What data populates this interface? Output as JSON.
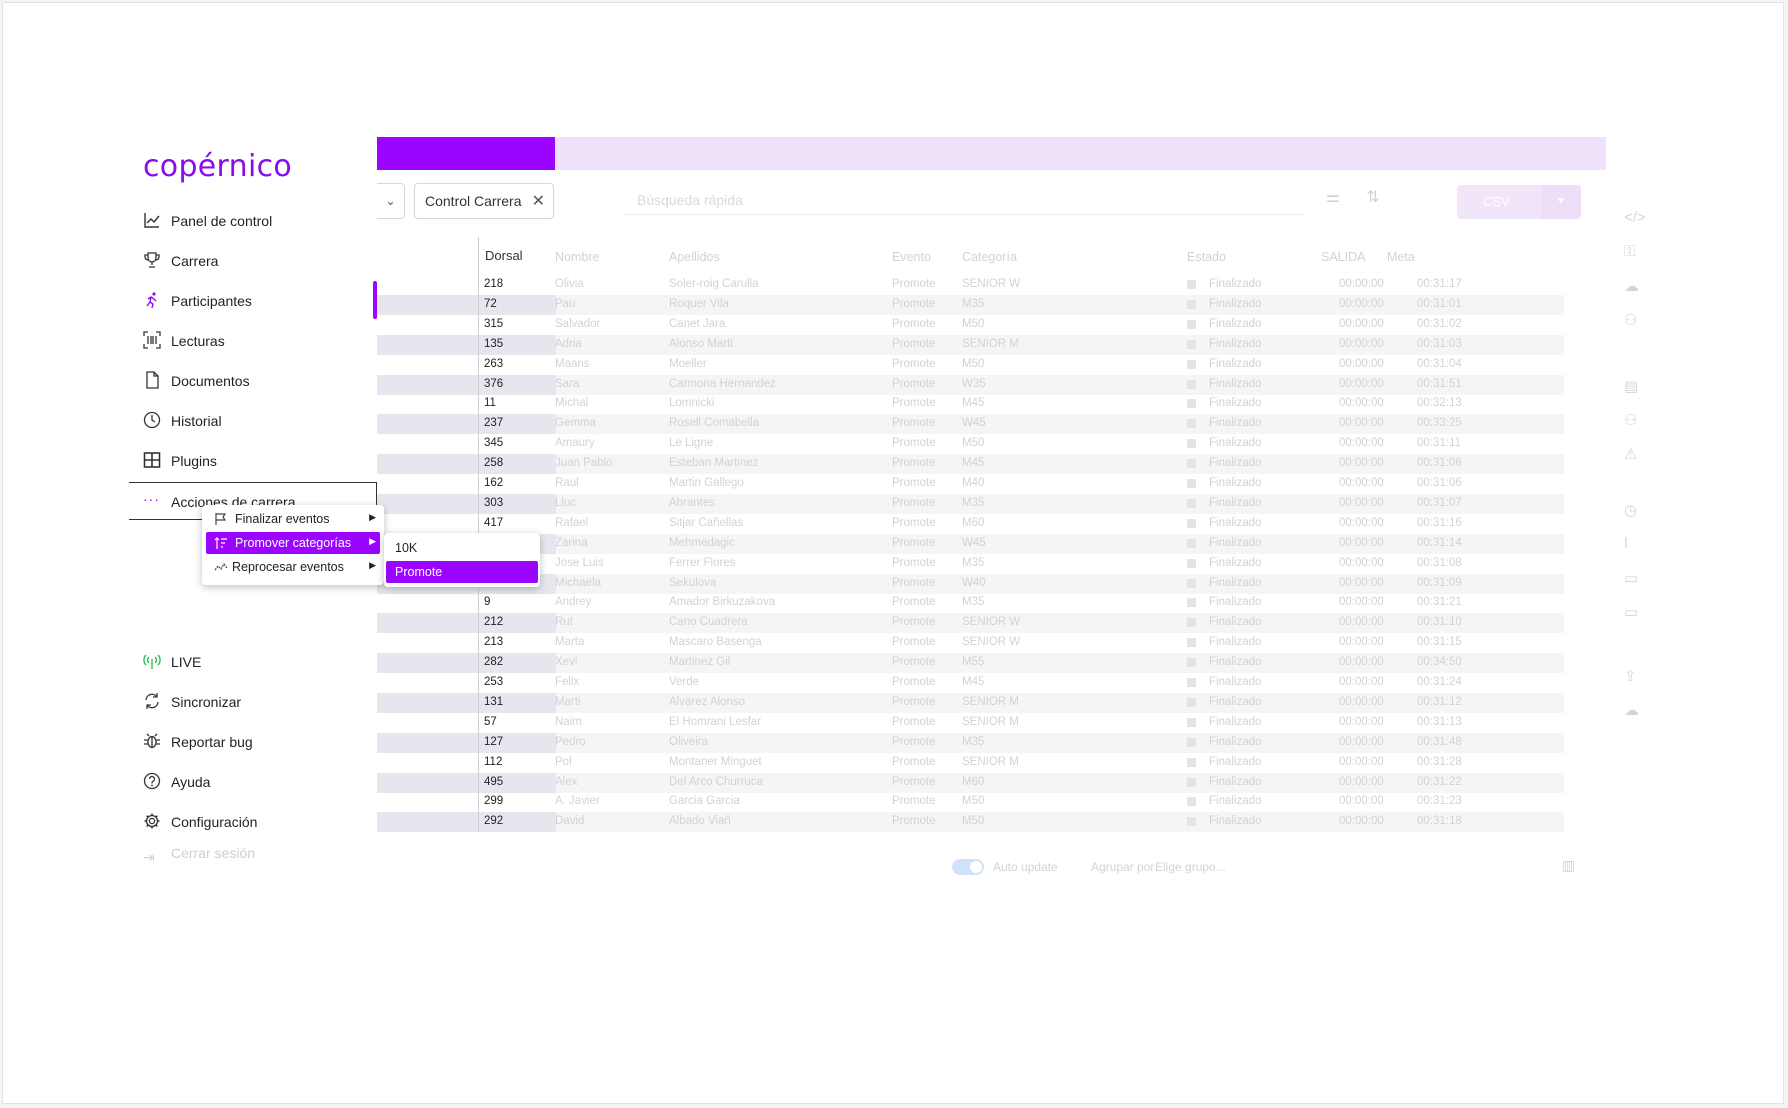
{
  "brand": {
    "logo_text": "copérnico",
    "accent": "#9b05ff"
  },
  "toolbar": {
    "filter_chip": "Control Carrera",
    "search_placeholder": "Búsqueda rápida",
    "csv_label": "CSV"
  },
  "sidebar": {
    "items": [
      {
        "label": "Panel de control",
        "icon": "chart-line-icon"
      },
      {
        "label": "Carrera",
        "icon": "trophy-icon"
      },
      {
        "label": "Participantes",
        "icon": "runner-icon"
      },
      {
        "label": "Lecturas",
        "icon": "barcode-icon"
      },
      {
        "label": "Documentos",
        "icon": "document-icon"
      },
      {
        "label": "Historial",
        "icon": "clock-icon"
      },
      {
        "label": "Plugins",
        "icon": "grid-icon"
      },
      {
        "label": "Acciones de carrera",
        "icon": "dots-icon"
      }
    ],
    "bottom_items": [
      {
        "label": "LIVE",
        "icon": "antenna-icon"
      },
      {
        "label": "Sincronizar",
        "icon": "sync-icon"
      },
      {
        "label": "Reportar bug",
        "icon": "bug-icon"
      },
      {
        "label": "Ayuda",
        "icon": "help-icon"
      },
      {
        "label": "Configuración",
        "icon": "gear-icon"
      }
    ],
    "logout": {
      "label": "Cerrar sesión"
    }
  },
  "context_menu": {
    "items": [
      {
        "label": "Finalizar eventos",
        "icon": "flag-icon"
      },
      {
        "label": "Promover categorías",
        "icon": "sort-up-icon"
      },
      {
        "label": "Reprocesar eventos",
        "icon": "reprocess-icon"
      }
    ],
    "submenu": [
      {
        "label": "10K"
      },
      {
        "label": "Promote"
      }
    ]
  },
  "table": {
    "headers": [
      "Dorsal",
      "Nombre",
      "Apellidos",
      "Evento",
      "Categoría",
      "Estado",
      "SALIDA",
      "Meta"
    ],
    "rows": [
      {
        "dorsal": "218",
        "nombre": "Olivia",
        "apellidos": "Soler-roig Carulla",
        "evento": "Promote",
        "categoria": "SENIOR W",
        "estado": "Finalizado",
        "salida": "00:00:00",
        "meta": "00:31:17"
      },
      {
        "dorsal": "72",
        "nombre": "Pau",
        "apellidos": "Roquer Vila",
        "evento": "Promote",
        "categoria": "M35",
        "estado": "Finalizado",
        "salida": "00:00:00",
        "meta": "00:31:01"
      },
      {
        "dorsal": "315",
        "nombre": "Salvador",
        "apellidos": "Canet Jara",
        "evento": "Promote",
        "categoria": "M50",
        "estado": "Finalizado",
        "salida": "00:00:00",
        "meta": "00:31:02"
      },
      {
        "dorsal": "135",
        "nombre": "Adria",
        "apellidos": "Alonso Marti",
        "evento": "Promote",
        "categoria": "SENIOR M",
        "estado": "Finalizado",
        "salida": "00:00:00",
        "meta": "00:31:03"
      },
      {
        "dorsal": "263",
        "nombre": "Maans",
        "apellidos": "Moeller",
        "evento": "Promote",
        "categoria": "M50",
        "estado": "Finalizado",
        "salida": "00:00:00",
        "meta": "00:31:04"
      },
      {
        "dorsal": "376",
        "nombre": "Sara",
        "apellidos": "Carmona Hernandez",
        "evento": "Promote",
        "categoria": "W35",
        "estado": "Finalizado",
        "salida": "00:00:00",
        "meta": "00:31:51"
      },
      {
        "dorsal": "11",
        "nombre": "Michal",
        "apellidos": "Lomnicki",
        "evento": "Promote",
        "categoria": "M45",
        "estado": "Finalizado",
        "salida": "00:00:00",
        "meta": "00:32:13"
      },
      {
        "dorsal": "237",
        "nombre": "Gemma",
        "apellidos": "Rosell Comabella",
        "evento": "Promote",
        "categoria": "W45",
        "estado": "Finalizado",
        "salida": "00:00:00",
        "meta": "00:33:25"
      },
      {
        "dorsal": "345",
        "nombre": "Amaury",
        "apellidos": "Le Ligne",
        "evento": "Promote",
        "categoria": "M50",
        "estado": "Finalizado",
        "salida": "00:00:00",
        "meta": "00:31:11"
      },
      {
        "dorsal": "258",
        "nombre": "Juan Pablo",
        "apellidos": "Esteban Martinez",
        "evento": "Promote",
        "categoria": "M45",
        "estado": "Finalizado",
        "salida": "00:00:00",
        "meta": "00:31:06"
      },
      {
        "dorsal": "162",
        "nombre": "Raul",
        "apellidos": "Martin Gallego",
        "evento": "Promote",
        "categoria": "M40",
        "estado": "Finalizado",
        "salida": "00:00:00",
        "meta": "00:31:06"
      },
      {
        "dorsal": "303",
        "nombre": "Lluc",
        "apellidos": "Abrantes",
        "evento": "Promote",
        "categoria": "M35",
        "estado": "Finalizado",
        "salida": "00:00:00",
        "meta": "00:31:07"
      },
      {
        "dorsal": "417",
        "nombre": "Rafael",
        "apellidos": "Sitjar Cañellas",
        "evento": "Promote",
        "categoria": "M60",
        "estado": "Finalizado",
        "salida": "00:00:00",
        "meta": "00:31:16"
      },
      {
        "dorsal": "",
        "nombre": "Zarina",
        "apellidos": "Mehmedagic",
        "evento": "Promote",
        "categoria": "W45",
        "estado": "Finalizado",
        "salida": "00:00:00",
        "meta": "00:31:14"
      },
      {
        "dorsal": "",
        "nombre": "Jose Luis",
        "apellidos": "Ferrer Flores",
        "evento": "Promote",
        "categoria": "M35",
        "estado": "Finalizado",
        "salida": "00:00:00",
        "meta": "00:31:08"
      },
      {
        "dorsal": "",
        "nombre": "Michaela",
        "apellidos": "Sekulova",
        "evento": "Promote",
        "categoria": "W40",
        "estado": "Finalizado",
        "salida": "00:00:00",
        "meta": "00:31:09"
      },
      {
        "dorsal": "9",
        "nombre": "Andrey",
        "apellidos": "Amador Birkuzakova",
        "evento": "Promote",
        "categoria": "M35",
        "estado": "Finalizado",
        "salida": "00:00:00",
        "meta": "00:31:21"
      },
      {
        "dorsal": "212",
        "nombre": "Rut",
        "apellidos": "Cano Cuadrera",
        "evento": "Promote",
        "categoria": "SENIOR W",
        "estado": "Finalizado",
        "salida": "00:00:00",
        "meta": "00:31:10"
      },
      {
        "dorsal": "213",
        "nombre": "Marta",
        "apellidos": "Mascaro Basenga",
        "evento": "Promote",
        "categoria": "SENIOR W",
        "estado": "Finalizado",
        "salida": "00:00:00",
        "meta": "00:31:15"
      },
      {
        "dorsal": "282",
        "nombre": "Xevi",
        "apellidos": "Martinez Gil",
        "evento": "Promote",
        "categoria": "M55",
        "estado": "Finalizado",
        "salida": "00:00:00",
        "meta": "00:34:50"
      },
      {
        "dorsal": "253",
        "nombre": "Felix",
        "apellidos": "Verde",
        "evento": "Promote",
        "categoria": "M45",
        "estado": "Finalizado",
        "salida": "00:00:00",
        "meta": "00:31:24"
      },
      {
        "dorsal": "131",
        "nombre": "Marti",
        "apellidos": "Alvarez Alonso",
        "evento": "Promote",
        "categoria": "SENIOR M",
        "estado": "Finalizado",
        "salida": "00:00:00",
        "meta": "00:31:12"
      },
      {
        "dorsal": "57",
        "nombre": "Naim",
        "apellidos": "El Homrani Lesfar",
        "evento": "Promote",
        "categoria": "SENIOR M",
        "estado": "Finalizado",
        "salida": "00:00:00",
        "meta": "00:31:13"
      },
      {
        "dorsal": "127",
        "nombre": "Pedro",
        "apellidos": "Oliveira",
        "evento": "Promote",
        "categoria": "M35",
        "estado": "Finalizado",
        "salida": "00:00:00",
        "meta": "00:31:48"
      },
      {
        "dorsal": "112",
        "nombre": "Pol",
        "apellidos": "Montaner Minguet",
        "evento": "Promote",
        "categoria": "SENIOR M",
        "estado": "Finalizado",
        "salida": "00:00:00",
        "meta": "00:31:28"
      },
      {
        "dorsal": "495",
        "nombre": "Alex",
        "apellidos": "Del Arco Churruca",
        "evento": "Promote",
        "categoria": "M60",
        "estado": "Finalizado",
        "salida": "00:00:00",
        "meta": "00:31:22"
      },
      {
        "dorsal": "299",
        "nombre": "A. Javier",
        "apellidos": "Garcia Garcia",
        "evento": "Promote",
        "categoria": "M50",
        "estado": "Finalizado",
        "salida": "00:00:00",
        "meta": "00:31:23"
      },
      {
        "dorsal": "292",
        "nombre": "David",
        "apellidos": "Albado Viaň",
        "evento": "Promote",
        "categoria": "M50",
        "estado": "Finalizado",
        "salida": "00:00:00",
        "meta": "00:31:18"
      }
    ]
  },
  "footer": {
    "auto_update_label": "Auto update",
    "group_label": "Agrupar por",
    "group_placeholder": "Elige grupo..."
  }
}
